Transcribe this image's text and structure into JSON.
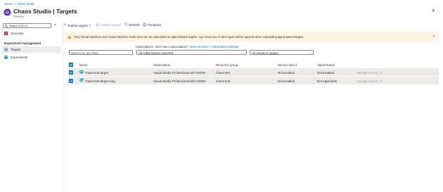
{
  "breadcrumb": {
    "home": "Home",
    "sep": ">",
    "current": "Chaos Studio"
  },
  "header": {
    "title": "Chaos Studio | Targets",
    "subtitle": "PREVIEW",
    "more": "···",
    "close": "✕"
  },
  "sidebar": {
    "search_placeholder": "Search (Ctrl+/)",
    "collapse": "«",
    "overview": "Overview",
    "section": "Experiment management",
    "targets": "Targets",
    "experiments": "Experiments"
  },
  "toolbar": {
    "enable": "Enable targets",
    "disable": "Disable targets",
    "refresh": "Refresh",
    "feedback": "Feedback"
  },
  "banner": {
    "text": "Only Virtual Machines and Virtual Machine Scale Sets can be onboarded as agent-based targets. Any resources of other types will be ignored when onboarding agent-based targets.",
    "close": "✕"
  },
  "subscriptions": {
    "label": "Subscriptions - Don't see a subscription?",
    "link": "Open Directory + Subscription settings"
  },
  "filters": {
    "search_placeholder": "Search for any field...",
    "subscriptions": "All subscriptions selected",
    "resource_groups": "All resource groups"
  },
  "table": {
    "columns": [
      "Name",
      "Subscription",
      "Resource group",
      "Service-direct",
      "Agent-based"
    ],
    "rows": [
      {
        "name": "chaos-test-target",
        "subscription": "Visual Studio Professional with MSDN",
        "group": "chaos-test",
        "service": "Not Enabled",
        "agent": "Not Enabled",
        "actions": "Manage actions"
      },
      {
        "name": "chaos-test-target-vmg",
        "subscription": "Visual Studio Professional with MSDN",
        "group": "chaos-test",
        "service": "Not Enabled",
        "agent": "Not Applicable",
        "actions": "Manage actions"
      }
    ]
  },
  "colors": {
    "accent": "#0078d4",
    "banner_bg": "#fdf4e4",
    "selected_row": "#edebe9",
    "warning": "#d47500"
  }
}
